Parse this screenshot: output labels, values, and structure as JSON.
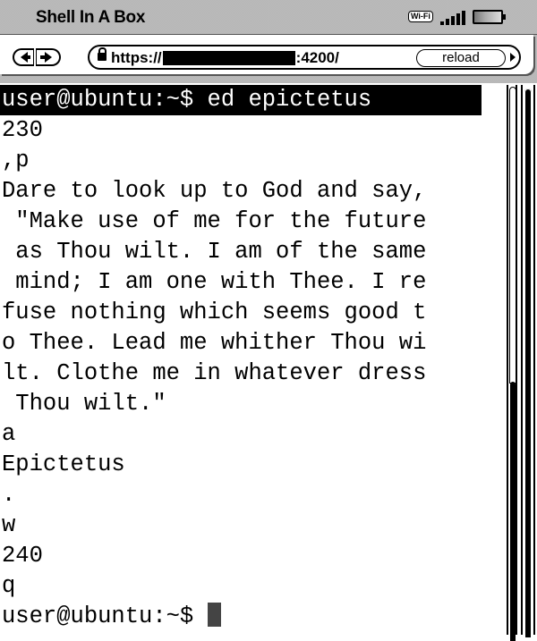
{
  "statusbar": {
    "title": "Shell In A Box",
    "wifi_label": "Wi-Fi",
    "icons": [
      "wifi-icon",
      "signal-strength-icon",
      "battery-icon"
    ]
  },
  "toolbar": {
    "back_icon": "back-arrow-icon",
    "forward_icon": "forward-arrow-icon",
    "url_prefix": "https://",
    "url_suffix": ":4200/",
    "lock_icon": "lock-icon",
    "reload_label": "reload",
    "go_icon": "play-arrow-icon"
  },
  "terminal": {
    "lines": [
      "user@ubuntu:~$ ed epictetus",
      "230",
      ",p",
      "Dare to look up to God and say,",
      " \"Make use of me for the future",
      " as Thou wilt. I am of the same",
      " mind; I am one with Thee. I re",
      "fuse nothing which seems good t",
      "o Thee. Lead me whither Thou wi",
      "lt. Clothe me in whatever dress",
      " Thou wilt.\"",
      "a",
      "Epictetus",
      ".",
      "w",
      "240",
      "q"
    ],
    "prompt": "user@ubuntu:~$ ",
    "cursor_color": "#444444"
  },
  "colors": {
    "foreground": "#000000",
    "background": "#ffffff",
    "highlight_bg": "#000000",
    "highlight_fg": "#ffffff"
  }
}
